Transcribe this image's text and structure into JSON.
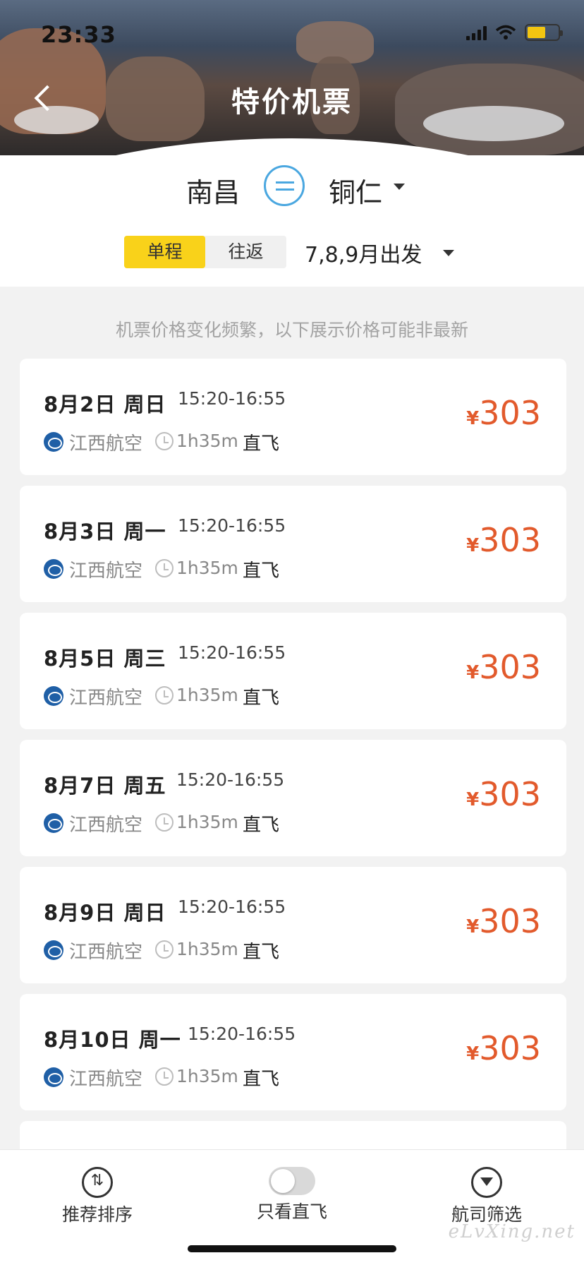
{
  "status_bar": {
    "time": "23:33"
  },
  "header": {
    "title": "特价机票"
  },
  "route": {
    "from": "南昌",
    "to": "铜仁",
    "trip_types": [
      "单程",
      "往返"
    ],
    "active_trip_type": "单程",
    "depart_label": "7,8,9月出发"
  },
  "notice": "机票价格变化频繁，以下展示价格可能非最新",
  "flights": [
    {
      "date": "8月2日 周日",
      "time": "15:20-16:55",
      "airline": "江西航空",
      "duration": "1h35m",
      "type": "直飞",
      "currency": "¥",
      "price": "303"
    },
    {
      "date": "8月3日 周一",
      "time": "15:20-16:55",
      "airline": "江西航空",
      "duration": "1h35m",
      "type": "直飞",
      "currency": "¥",
      "price": "303"
    },
    {
      "date": "8月5日 周三",
      "time": "15:20-16:55",
      "airline": "江西航空",
      "duration": "1h35m",
      "type": "直飞",
      "currency": "¥",
      "price": "303"
    },
    {
      "date": "8月7日 周五",
      "time": "15:20-16:55",
      "airline": "江西航空",
      "duration": "1h35m",
      "type": "直飞",
      "currency": "¥",
      "price": "303"
    },
    {
      "date": "8月9日 周日",
      "time": "15:20-16:55",
      "airline": "江西航空",
      "duration": "1h35m",
      "type": "直飞",
      "currency": "¥",
      "price": "303"
    },
    {
      "date": "8月10日 周一",
      "time": "15:20-16:55",
      "airline": "江西航空",
      "duration": "1h35m",
      "type": "直飞",
      "currency": "¥",
      "price": "303"
    }
  ],
  "bottom_bar": {
    "sort_label": "推荐排序",
    "direct_only_label": "只看直飞",
    "direct_only_on": false,
    "filter_label": "航司筛选"
  },
  "watermark": "eLvXing.net",
  "colors": {
    "accent_yellow": "#f9d21a",
    "price_red": "#e25a2c",
    "swap_blue": "#4aa7e0",
    "airline_blue": "#1f5fa6"
  }
}
